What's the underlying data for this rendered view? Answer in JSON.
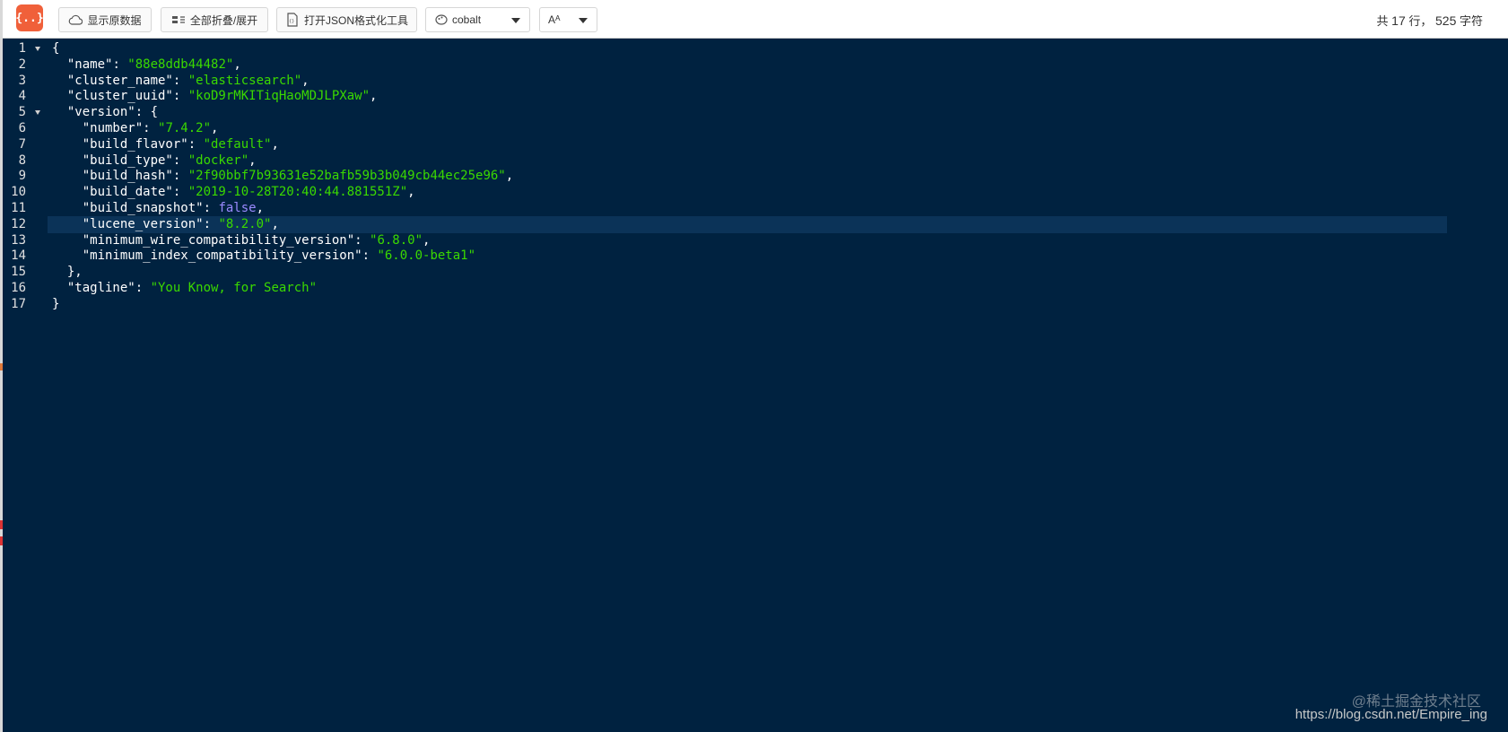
{
  "app": {
    "logo_text": "{..}"
  },
  "toolbar": {
    "show_raw_label": "显示原数据",
    "toggle_all_label": "全部折叠/展开",
    "open_tool_label": "打开JSON格式化工具",
    "theme": {
      "value": "cobalt"
    },
    "font": {
      "value": "Aᴬ"
    }
  },
  "stats": {
    "prefix": "共",
    "lines": "17",
    "mid": "行，",
    "chars": "525",
    "suffix": "字符"
  },
  "editor": {
    "colors": {
      "background": "#002240",
      "string": "#3ad900",
      "boolean": "#9b8aff",
      "active_line": "#0b3358"
    },
    "active_line": 12,
    "lines": [
      {
        "n": "1",
        "fold": true,
        "tokens": [
          {
            "t": "p",
            "v": "{"
          }
        ]
      },
      {
        "n": "2",
        "fold": false,
        "tokens": [
          {
            "t": "k",
            "v": "  \"name\""
          },
          {
            "t": "p",
            "v": ": "
          },
          {
            "t": "s",
            "v": "\"88e8ddb44482\""
          },
          {
            "t": "p",
            "v": ","
          }
        ]
      },
      {
        "n": "3",
        "fold": false,
        "tokens": [
          {
            "t": "k",
            "v": "  \"cluster_name\""
          },
          {
            "t": "p",
            "v": ": "
          },
          {
            "t": "s",
            "v": "\"elasticsearch\""
          },
          {
            "t": "p",
            "v": ","
          }
        ]
      },
      {
        "n": "4",
        "fold": false,
        "tokens": [
          {
            "t": "k",
            "v": "  \"cluster_uuid\""
          },
          {
            "t": "p",
            "v": ": "
          },
          {
            "t": "s",
            "v": "\"koD9rMKITiqHaoMDJLPXaw\""
          },
          {
            "t": "p",
            "v": ","
          }
        ]
      },
      {
        "n": "5",
        "fold": true,
        "tokens": [
          {
            "t": "k",
            "v": "  \"version\""
          },
          {
            "t": "p",
            "v": ": {"
          }
        ]
      },
      {
        "n": "6",
        "fold": false,
        "tokens": [
          {
            "t": "k",
            "v": "    \"number\""
          },
          {
            "t": "p",
            "v": ": "
          },
          {
            "t": "s",
            "v": "\"7.4.2\""
          },
          {
            "t": "p",
            "v": ","
          }
        ]
      },
      {
        "n": "7",
        "fold": false,
        "tokens": [
          {
            "t": "k",
            "v": "    \"build_flavor\""
          },
          {
            "t": "p",
            "v": ": "
          },
          {
            "t": "s",
            "v": "\"default\""
          },
          {
            "t": "p",
            "v": ","
          }
        ]
      },
      {
        "n": "8",
        "fold": false,
        "tokens": [
          {
            "t": "k",
            "v": "    \"build_type\""
          },
          {
            "t": "p",
            "v": ": "
          },
          {
            "t": "s",
            "v": "\"docker\""
          },
          {
            "t": "p",
            "v": ","
          }
        ]
      },
      {
        "n": "9",
        "fold": false,
        "tokens": [
          {
            "t": "k",
            "v": "    \"build_hash\""
          },
          {
            "t": "p",
            "v": ": "
          },
          {
            "t": "s",
            "v": "\"2f90bbf7b93631e52bafb59b3b049cb44ec25e96\""
          },
          {
            "t": "p",
            "v": ","
          }
        ]
      },
      {
        "n": "10",
        "fold": false,
        "tokens": [
          {
            "t": "k",
            "v": "    \"build_date\""
          },
          {
            "t": "p",
            "v": ": "
          },
          {
            "t": "s",
            "v": "\"2019-10-28T20:40:44.881551Z\""
          },
          {
            "t": "p",
            "v": ","
          }
        ]
      },
      {
        "n": "11",
        "fold": false,
        "tokens": [
          {
            "t": "k",
            "v": "    \"build_snapshot\""
          },
          {
            "t": "p",
            "v": ": "
          },
          {
            "t": "b",
            "v": "false"
          },
          {
            "t": "p",
            "v": ","
          }
        ]
      },
      {
        "n": "12",
        "fold": false,
        "tokens": [
          {
            "t": "k",
            "v": "    \"lucene_version\""
          },
          {
            "t": "p",
            "v": ": "
          },
          {
            "t": "s",
            "v": "\"8.2.0\""
          },
          {
            "t": "p",
            "v": ","
          }
        ]
      },
      {
        "n": "13",
        "fold": false,
        "tokens": [
          {
            "t": "k",
            "v": "    \"minimum_wire_compatibility_version\""
          },
          {
            "t": "p",
            "v": ": "
          },
          {
            "t": "s",
            "v": "\"6.8.0\""
          },
          {
            "t": "p",
            "v": ","
          }
        ]
      },
      {
        "n": "14",
        "fold": false,
        "tokens": [
          {
            "t": "k",
            "v": "    \"minimum_index_compatibility_version\""
          },
          {
            "t": "p",
            "v": ": "
          },
          {
            "t": "s",
            "v": "\"6.0.0-beta1\""
          }
        ]
      },
      {
        "n": "15",
        "fold": false,
        "tokens": [
          {
            "t": "p",
            "v": "  },"
          }
        ]
      },
      {
        "n": "16",
        "fold": false,
        "tokens": [
          {
            "t": "k",
            "v": "  \"tagline\""
          },
          {
            "t": "p",
            "v": ": "
          },
          {
            "t": "s",
            "v": "\"You Know, for Search\""
          }
        ]
      },
      {
        "n": "17",
        "fold": false,
        "tokens": [
          {
            "t": "p",
            "v": "}"
          }
        ]
      }
    ]
  },
  "watermark": "@稀土掘金技术社区",
  "url_overlay": "https://blog.csdn.net/Empire_ing"
}
